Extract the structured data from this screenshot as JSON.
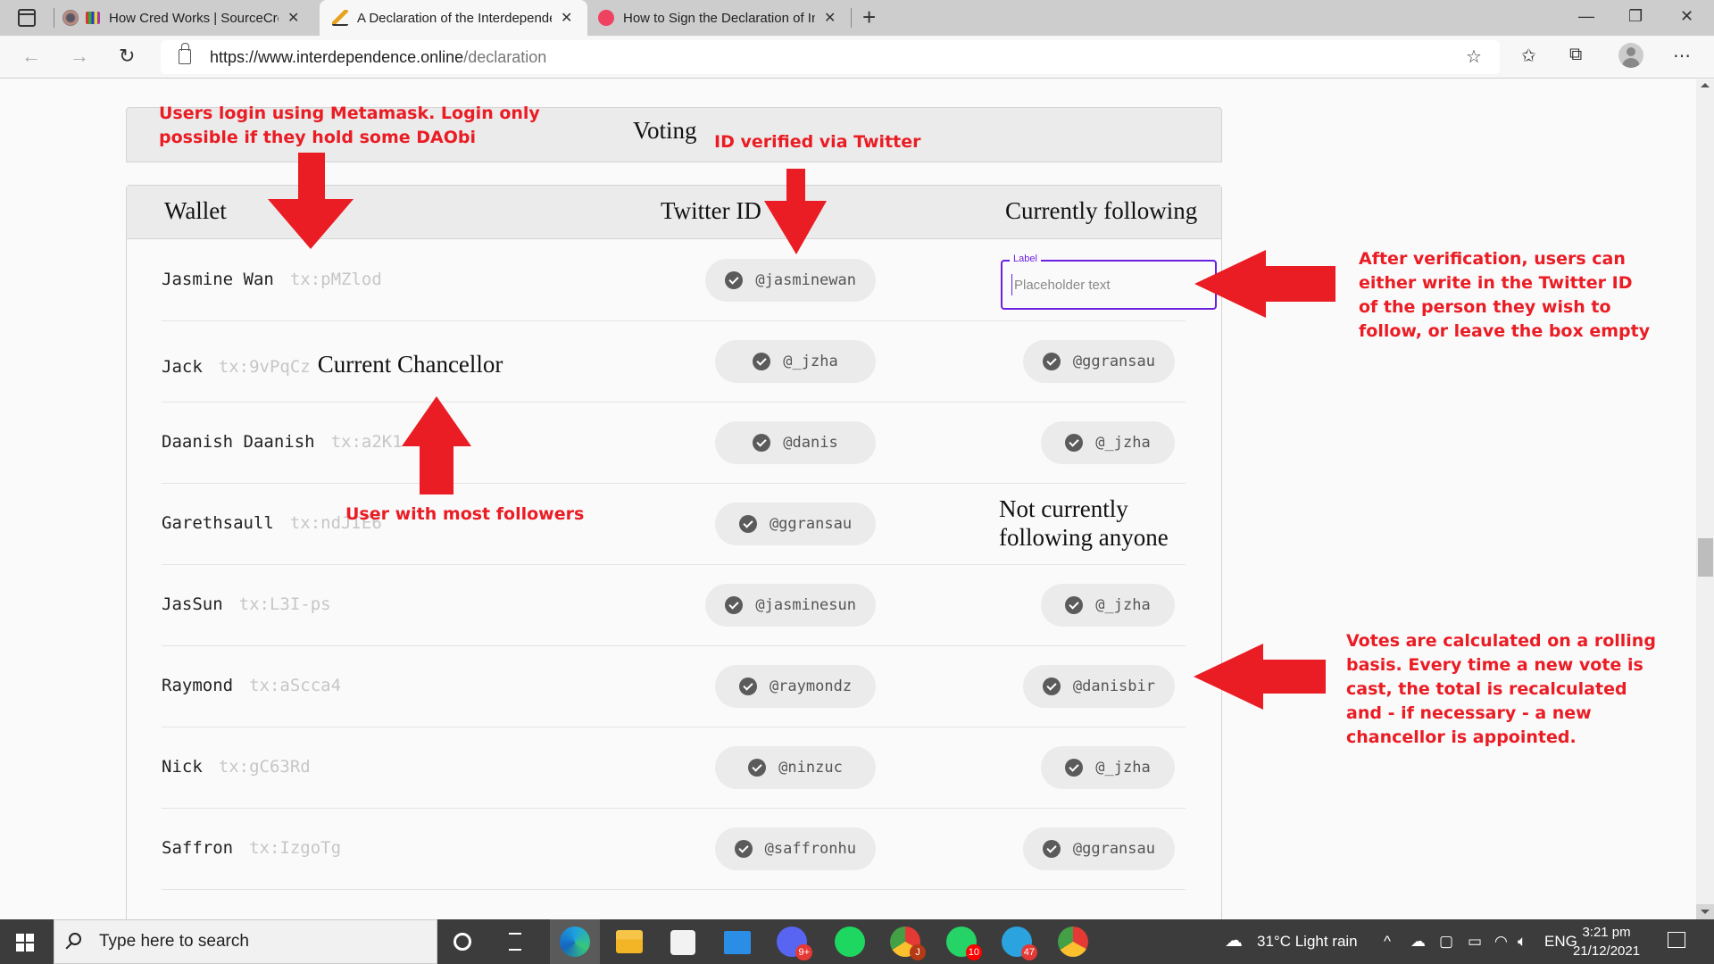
{
  "browser": {
    "tabs": [
      {
        "title": "How Cred Works | SourceCred",
        "active": false,
        "favicon": "sourcecred-icon"
      },
      {
        "title": "A Declaration of the Interdependence",
        "active": true,
        "favicon": "quill-icon"
      },
      {
        "title": "How to Sign the Declaration of Interdependence",
        "active": false,
        "favicon": "red-logo-icon"
      }
    ],
    "close_glyph": "✕",
    "new_tab_glyph": "+",
    "url_host": "https://www.interdependence.online",
    "url_path": "/declaration",
    "window_controls": {
      "minimize": "—",
      "maximize": "❐",
      "close": "✕"
    }
  },
  "page": {
    "voting_title": "Voting",
    "columns": {
      "wallet": "Wallet",
      "twitter": "Twitter ID",
      "following": "Currently following"
    },
    "current_chancellor_label": "Current Chancellor",
    "not_following_label": "Not currently following anyone",
    "follow_input": {
      "label": "Label",
      "placeholder": "Placeholder text",
      "value": ""
    },
    "rows": [
      {
        "name": "Jasmine Wan",
        "tx": "tx:pMZlod",
        "twitter": "@jasminewan",
        "following": null,
        "following_input": true
      },
      {
        "name": "Jack",
        "tx": "tx:9vPqCz",
        "twitter": "@_jzha",
        "following": "@ggransau",
        "chancellor": true
      },
      {
        "name": "Daanish Daanish",
        "tx": "tx:a2K1",
        "twitter": "@danis",
        "following": "@_jzha"
      },
      {
        "name": "Garethsaull",
        "tx": "tx:ndJIE6",
        "twitter": "@ggransau",
        "following": null,
        "not_following": true
      },
      {
        "name": "JasSun",
        "tx": "tx:L3I-ps",
        "twitter": "@jasminesun",
        "following": "@_jzha"
      },
      {
        "name": "Raymond",
        "tx": "tx:aScca4",
        "twitter": "@raymondz",
        "following": "@danisbir"
      },
      {
        "name": "Nick",
        "tx": "tx:gC63Rd",
        "twitter": "@ninzuc",
        "following": "@_jzha"
      },
      {
        "name": "Saffron",
        "tx": "tx:IzgoTg",
        "twitter": "@saffronhu",
        "following": "@ggransau"
      }
    ]
  },
  "annotations": {
    "login": "Users login using Metamask. Login only possible if they hold some DAObi",
    "twitter": "ID verified via Twitter",
    "most_followers": "User with most followers",
    "after_verification": "After verification, users can either write in the Twitter ID of the person they wish to follow, or leave the box empty",
    "rolling": "Votes are calculated on a rolling basis. Every time a new vote is cast, the total is recalculated and - if necessary - a new chancellor is appointed.",
    "color": "#ea1c24"
  },
  "taskbar": {
    "search_placeholder": "Type here to search",
    "apps": [
      {
        "name": "edge",
        "badge": null
      },
      {
        "name": "file-explorer",
        "badge": null
      },
      {
        "name": "microsoft-store",
        "badge": null
      },
      {
        "name": "mail",
        "badge": null
      },
      {
        "name": "discord",
        "badge": "9+"
      },
      {
        "name": "spotify",
        "badge": null
      },
      {
        "name": "chrome-profile-j",
        "badge": "J"
      },
      {
        "name": "whatsapp",
        "badge": "10"
      },
      {
        "name": "telegram",
        "badge": "47"
      },
      {
        "name": "chrome-profile-2",
        "badge": null
      }
    ],
    "weather": "31°C  Light rain",
    "language": "ENG",
    "time": "3:21 pm",
    "date": "21/12/2021"
  }
}
